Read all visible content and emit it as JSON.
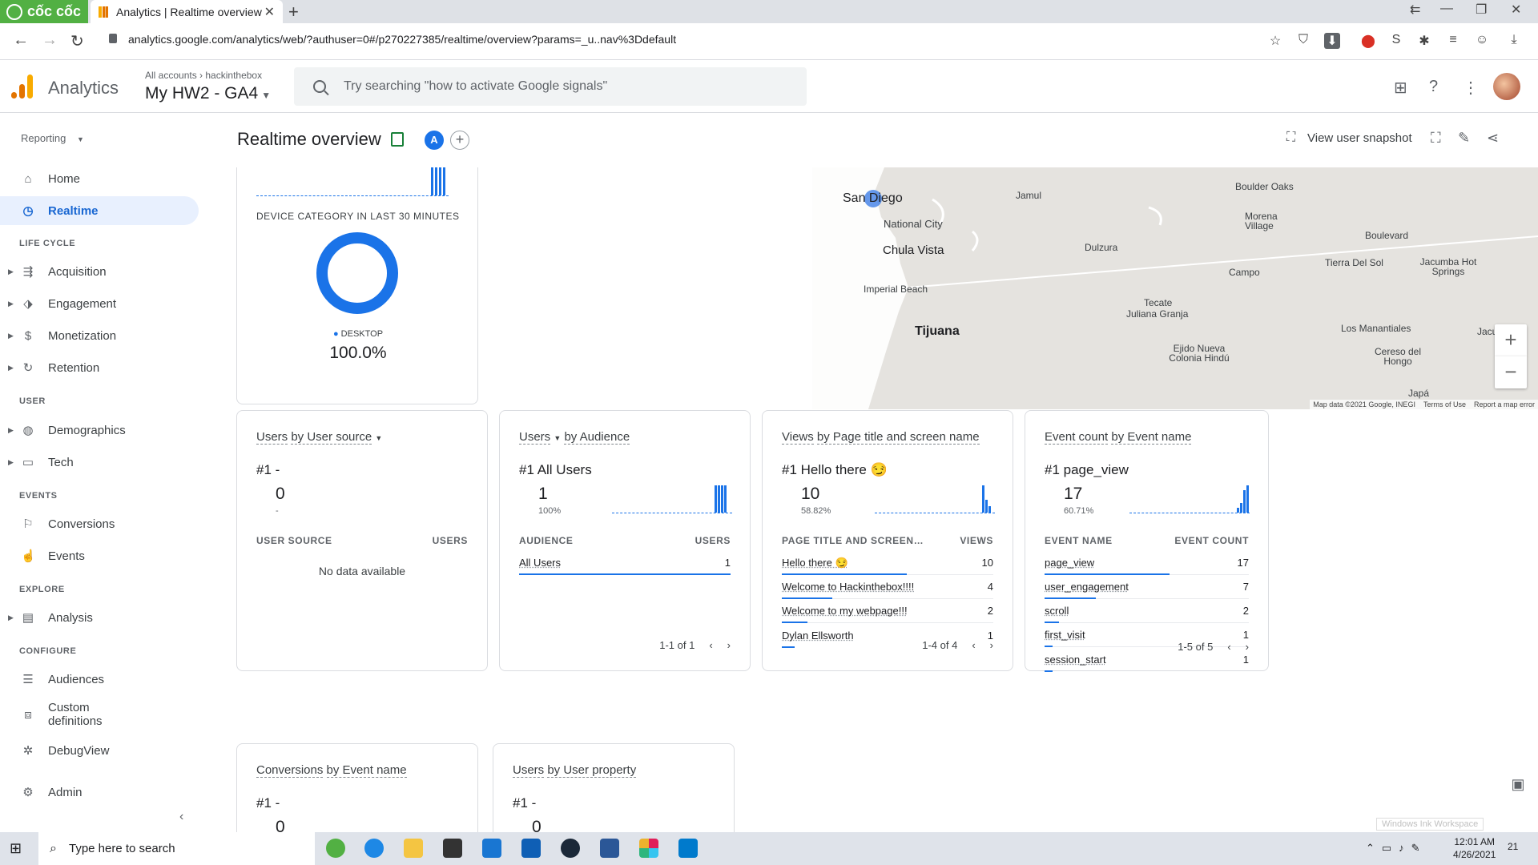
{
  "browser": {
    "brand": "cốc cốc",
    "tab_title": "Analytics | Realtime overview",
    "url": "analytics.google.com/analytics/web/?authuser=0#/p270227385/realtime/overview?params=_u..nav%3Ddefault"
  },
  "header": {
    "app_name": "Analytics",
    "crumb_all": "All accounts",
    "crumb_account": "hackinthebox",
    "property": "My HW2 - GA4",
    "search_placeholder": "Try searching \"how to activate Google signals\""
  },
  "sidebar": {
    "reporting_label": "Reporting",
    "home": "Home",
    "realtime": "Realtime",
    "section_lifecycle": "LIFE CYCLE",
    "acquisition": "Acquisition",
    "engagement": "Engagement",
    "monetization": "Monetization",
    "retention": "Retention",
    "section_user": "USER",
    "demographics": "Demographics",
    "tech": "Tech",
    "section_events": "EVENTS",
    "conversions": "Conversions",
    "events": "Events",
    "section_explore": "EXPLORE",
    "analysis": "Analysis",
    "section_configure": "CONFIGURE",
    "audiences": "Audiences",
    "custom_definitions": "Custom definitions",
    "debugview": "DebugView",
    "admin": "Admin"
  },
  "page": {
    "title": "Realtime overview",
    "compare_badge": "A",
    "view_snapshot": "View user snapshot"
  },
  "device_card": {
    "title": "DEVICE CATEGORY IN LAST 30 MINUTES",
    "legend": "DESKTOP",
    "value": "100.0%",
    "desktop_fraction": 1.0
  },
  "map": {
    "labels": [
      "San Diego",
      "Jamul",
      "Boulder Oaks",
      "National City",
      "Morena Village",
      "Chula Vista",
      "Dulzura",
      "Boulevard",
      "Tierra Del Sol",
      "Jacumba Hot Springs",
      "Campo",
      "Imperial Beach",
      "Tecate",
      "Juliana Granja",
      "Tijuana",
      "Los Manantiales",
      "Ejido Nueva Colonia Hindú",
      "Cereso del Hongo",
      "Jacumba",
      "Japá"
    ],
    "attribution": "Map data ©2021 Google, INEGI",
    "terms": "Terms of Use",
    "report": "Report a map error"
  },
  "cards": {
    "source": {
      "title_a": "Users",
      "title_b": "by User source",
      "rank": "#1  -",
      "value": "0",
      "pct": "-",
      "col1": "USER SOURCE",
      "col2": "USERS",
      "empty": "No data available"
    },
    "audience": {
      "title_a": "Users",
      "title_b": "by Audience",
      "rank": "#1  All Users",
      "value": "1",
      "pct": "100%",
      "col1": "AUDIENCE",
      "col2": "USERS",
      "rows": [
        {
          "label": "All Users",
          "value": "1",
          "share": 1.0
        }
      ],
      "pager": "1-1 of 1"
    },
    "pages": {
      "title_a": "Views",
      "title_b": "by Page title and screen name",
      "rank": "#1  Hello there 😏",
      "value": "10",
      "pct": "58.82%",
      "col1": "PAGE TITLE AND SCREEN…",
      "col2": "VIEWS",
      "rows": [
        {
          "label": "Hello there 😏",
          "value": "10",
          "share": 0.59
        },
        {
          "label": "Welcome to Hackinthebox!!!!",
          "value": "4",
          "share": 0.24
        },
        {
          "label": "Welcome to my webpage!!!",
          "value": "2",
          "share": 0.12
        },
        {
          "label": "Dylan Ellsworth",
          "value": "1",
          "share": 0.06
        }
      ],
      "pager": "1-4 of 4"
    },
    "events": {
      "title_a": "Event count",
      "title_b": "by Event name",
      "rank": "#1  page_view",
      "value": "17",
      "pct": "60.71%",
      "col1": "EVENT NAME",
      "col2": "EVENT COUNT",
      "rows": [
        {
          "label": "page_view",
          "value": "17",
          "share": 0.61
        },
        {
          "label": "user_engagement",
          "value": "7",
          "share": 0.25
        },
        {
          "label": "scroll",
          "value": "2",
          "share": 0.07
        },
        {
          "label": "first_visit",
          "value": "1",
          "share": 0.04
        },
        {
          "label": "session_start",
          "value": "1",
          "share": 0.04
        }
      ],
      "pager": "1-5 of 5"
    },
    "conversions": {
      "title_a": "Conversions",
      "title_b": "by Event name",
      "rank": "#1  -",
      "value": "0"
    },
    "userprop": {
      "title_a": "Users",
      "title_b": "by User property",
      "rank": "#1  -",
      "value": "0"
    }
  },
  "taskbar": {
    "search_placeholder": "Type here to search",
    "time": "12:01 AM",
    "date": "4/26/2021",
    "notifications": "21",
    "ink_workspace": "Windows Ink Workspace"
  },
  "colors": {
    "accent": "#1a73e8",
    "active_bg": "#e8f0fe",
    "brand_green": "#52b043"
  }
}
